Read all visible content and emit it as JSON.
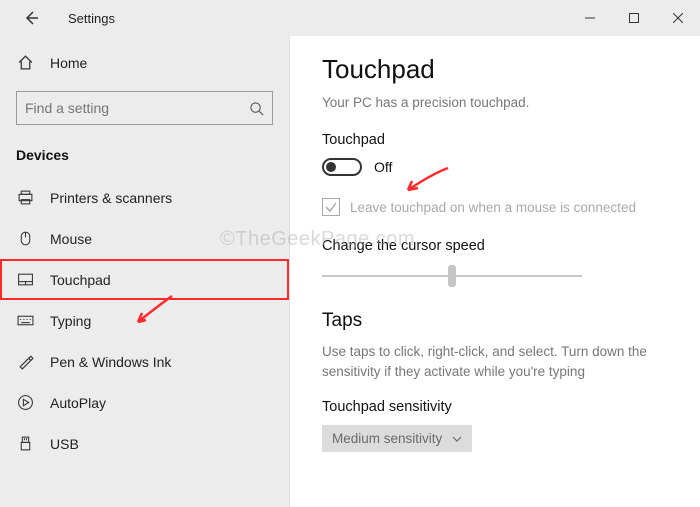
{
  "titlebar": {
    "title": "Settings"
  },
  "sidebar": {
    "home": "Home",
    "search_placeholder": "Find a setting",
    "category": "Devices",
    "items": [
      {
        "label": "Printers & scanners"
      },
      {
        "label": "Mouse"
      },
      {
        "label": "Touchpad"
      },
      {
        "label": "Typing"
      },
      {
        "label": "Pen & Windows Ink"
      },
      {
        "label": "AutoPlay"
      },
      {
        "label": "USB"
      }
    ],
    "selected_index": 2
  },
  "main": {
    "title": "Touchpad",
    "subtitle": "Your PC has a precision touchpad.",
    "toggle_label": "Touchpad",
    "toggle_state": "Off",
    "toggle_checked": false,
    "checkbox_label": "Leave touchpad on when a mouse is connected",
    "checkbox_checked": true,
    "checkbox_disabled": true,
    "slider_label": "Change the cursor speed",
    "section2_title": "Taps",
    "section2_desc": "Use taps to click, right-click, and select. Turn down the sensitivity if they activate while you're typing",
    "sensitivity_label": "Touchpad sensitivity",
    "sensitivity_value": "Medium sensitivity"
  },
  "watermark": "©TheGeekPage.com"
}
